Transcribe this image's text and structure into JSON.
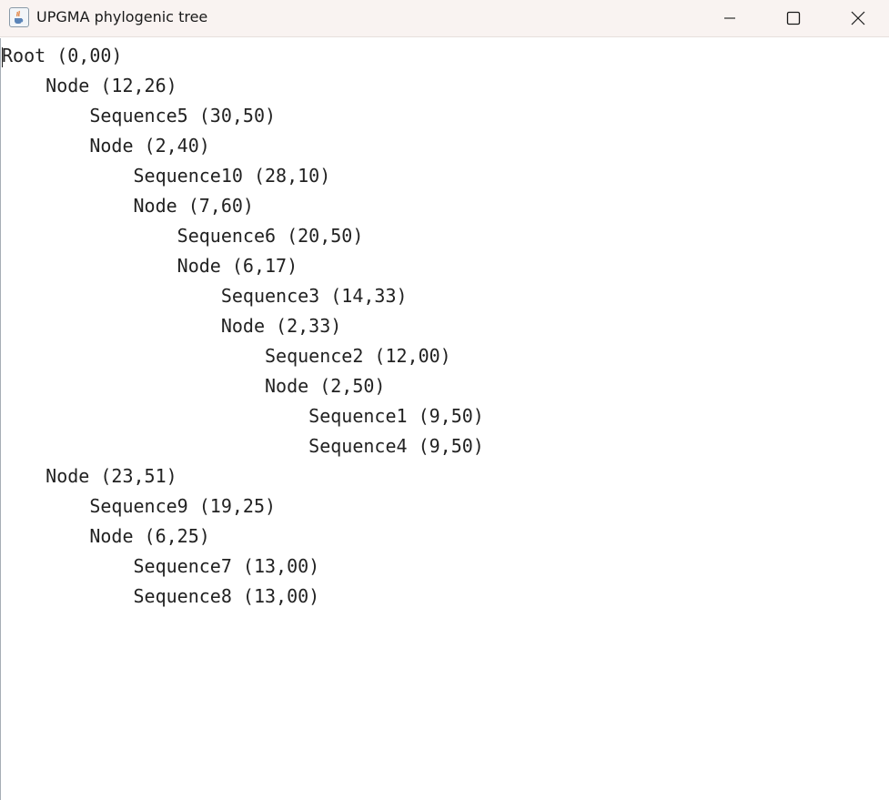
{
  "window": {
    "title": "UPGMA phylogenic tree",
    "icon": "java-cup-icon",
    "controls": [
      "minimize-icon",
      "maximize-icon",
      "close-icon"
    ]
  },
  "tree": [
    {
      "label": "Root",
      "value": "(0,00)",
      "depth": 0
    },
    {
      "label": "Node",
      "value": "(12,26)",
      "depth": 1
    },
    {
      "label": "Sequence5",
      "value": "(30,50)",
      "depth": 2
    },
    {
      "label": "Node",
      "value": "(2,40)",
      "depth": 2
    },
    {
      "label": "Sequence10",
      "value": "(28,10)",
      "depth": 3
    },
    {
      "label": "Node",
      "value": "(7,60)",
      "depth": 3
    },
    {
      "label": "Sequence6",
      "value": "(20,50)",
      "depth": 4
    },
    {
      "label": "Node",
      "value": "(6,17)",
      "depth": 4
    },
    {
      "label": "Sequence3",
      "value": "(14,33)",
      "depth": 5
    },
    {
      "label": "Node",
      "value": "(2,33)",
      "depth": 5
    },
    {
      "label": "Sequence2",
      "value": "(12,00)",
      "depth": 6
    },
    {
      "label": "Node",
      "value": "(2,50)",
      "depth": 6
    },
    {
      "label": "Sequence1",
      "value": "(9,50)",
      "depth": 7
    },
    {
      "label": "Sequence4",
      "value": "(9,50)",
      "depth": 7
    },
    {
      "label": "Node",
      "value": "(23,51)",
      "depth": 1
    },
    {
      "label": "Sequence9",
      "value": "(19,25)",
      "depth": 2
    },
    {
      "label": "Node",
      "value": "(6,25)",
      "depth": 2
    },
    {
      "label": "Sequence7",
      "value": "(13,00)",
      "depth": 3
    },
    {
      "label": "Sequence8",
      "value": "(13,00)",
      "depth": 3
    }
  ]
}
